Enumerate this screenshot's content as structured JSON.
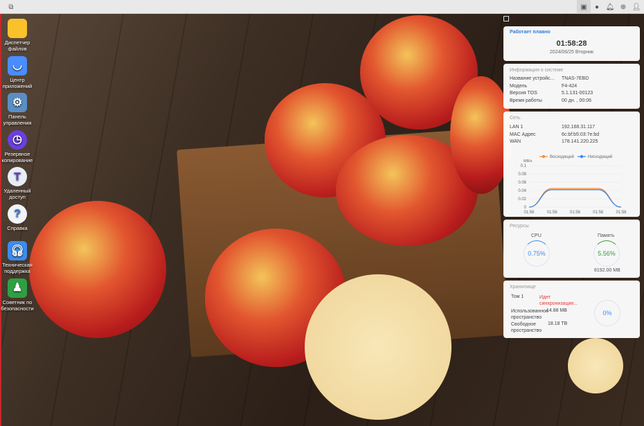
{
  "topbar": {
    "icons": [
      "windows-icon",
      "desktop-icon",
      "chat-icon",
      "bell-icon",
      "globe-icon",
      "user-icon"
    ]
  },
  "desktop": [
    {
      "label": "Диспетчер файлов",
      "icon": "folder-icon",
      "color": "#f9c22b"
    },
    {
      "label": "Центр приложений",
      "icon": "shopping-bag-icon",
      "color": "#4a8dff"
    },
    {
      "label": "Панель управления",
      "icon": "gear-icon",
      "color": "#5a8fc4"
    },
    {
      "label": "Резервное копирование",
      "icon": "clock-backup-icon",
      "color": "#6b3fe0"
    },
    {
      "label": "Удаленный доступ",
      "icon": "cloud-t-icon",
      "color": "#e8eef8"
    },
    {
      "label": "Справка",
      "icon": "help-icon",
      "color": "#f2f4f8"
    },
    {
      "label": "Техническая поддержка",
      "icon": "headset-icon",
      "color": "#3a8cf0"
    },
    {
      "label": "Советник по безопасности",
      "icon": "shield-icon",
      "color": "#2ea043"
    }
  ],
  "status": {
    "title": "Работает плавно",
    "time": "01:58:28",
    "date": "2024/06/25 Вторник"
  },
  "sysinfo": {
    "title": "Информация о системе",
    "rows": [
      {
        "k": "Название устройс...",
        "v": "TNAS-7EBD"
      },
      {
        "k": "Модель",
        "v": "F4-424"
      },
      {
        "k": "Версия TOS",
        "v": "5.1.131-00123"
      },
      {
        "k": "Время работы",
        "v": "00 дн. , 00:06"
      }
    ]
  },
  "network": {
    "title": "Сеть",
    "rows": [
      {
        "k": "LAN 1",
        "v": "192.168.31.117"
      },
      {
        "k": "MAC Адрес",
        "v": "6c:bf:b5:03:7e:bd"
      },
      {
        "k": "WAN",
        "v": "178.141.220.225"
      }
    ]
  },
  "chart_data": {
    "type": "line",
    "ylabel": "MB/s",
    "ylim": [
      0,
      0.1
    ],
    "yticks": [
      "0.1",
      "0.08",
      "0.06",
      "0.04",
      "0.02",
      "0"
    ],
    "categories": [
      "01:56",
      "01:56",
      "01:56",
      "01:56",
      "01:58"
    ],
    "series": [
      {
        "name": "Восходящий",
        "color": "#ff8c2e",
        "values": [
          0,
          0.045,
          0.045,
          0.045,
          0
        ]
      },
      {
        "name": "Нисходящий",
        "color": "#3a8cf0",
        "values": [
          0,
          0.042,
          0.042,
          0.042,
          0
        ]
      }
    ]
  },
  "resources": {
    "title": "Ресурсы",
    "cpu_label": "CPU",
    "cpu": "0.75%",
    "cpu_frac": 0.0075,
    "mem_label": "Память",
    "mem": "5.56%",
    "mem_frac": 0.0556,
    "mem_total": "8192.00 MB"
  },
  "storage": {
    "title": "Хранилище",
    "vol": "Том 1",
    "vol_status": "Идет синхронизация...",
    "used_label": "Использованное пространство",
    "used": "14.88 MB",
    "free_label": "Свободное пространство",
    "free": "18.18 TB",
    "pct": "0%"
  }
}
